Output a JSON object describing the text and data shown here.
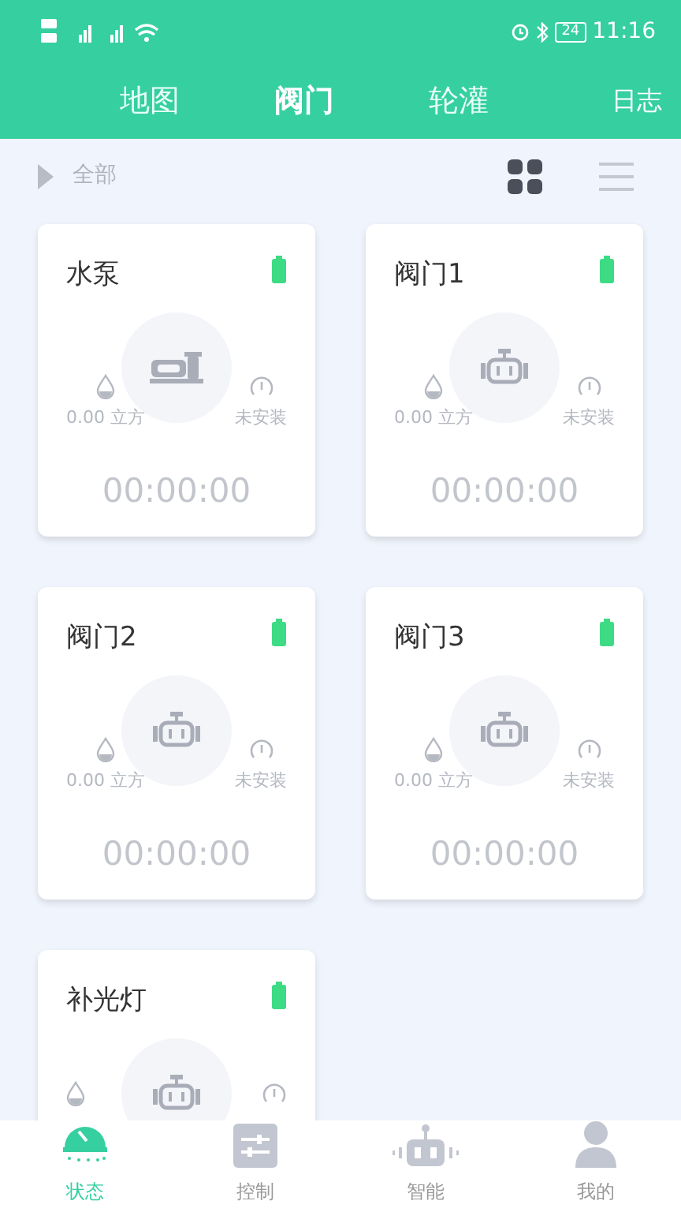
{
  "status_bar": {
    "battery": "24",
    "time": "11:16"
  },
  "header": {
    "tabs": [
      {
        "label": "地图",
        "selected": false
      },
      {
        "label": "阀门",
        "selected": true
      },
      {
        "label": "轮灌",
        "selected": false
      }
    ],
    "action": "日志"
  },
  "filter": {
    "label": "全部",
    "views": [
      {
        "kind": "grid",
        "selected": true
      },
      {
        "kind": "list",
        "selected": false
      }
    ]
  },
  "devices": [
    {
      "name": "水泵",
      "kind": "pump",
      "volume": "0.00 立方",
      "meter": "未安装",
      "timer": "00:00:00"
    },
    {
      "name": "阀门1",
      "kind": "valve",
      "volume": "0.00 立方",
      "meter": "未安装",
      "timer": "00:00:00"
    },
    {
      "name": "阀门2",
      "kind": "valve",
      "volume": "0.00 立方",
      "meter": "未安装",
      "timer": "00:00:00"
    },
    {
      "name": "阀门3",
      "kind": "valve",
      "volume": "0.00 立方",
      "meter": "未安装",
      "timer": "00:00:00"
    },
    {
      "name": "补光灯",
      "kind": "valve"
    }
  ],
  "bottom_nav": [
    {
      "label": "状态",
      "kind": "status",
      "selected": true
    },
    {
      "label": "控制",
      "kind": "control",
      "selected": false
    },
    {
      "label": "智能",
      "kind": "smart",
      "selected": false
    },
    {
      "label": "我的",
      "kind": "me",
      "selected": false
    }
  ]
}
